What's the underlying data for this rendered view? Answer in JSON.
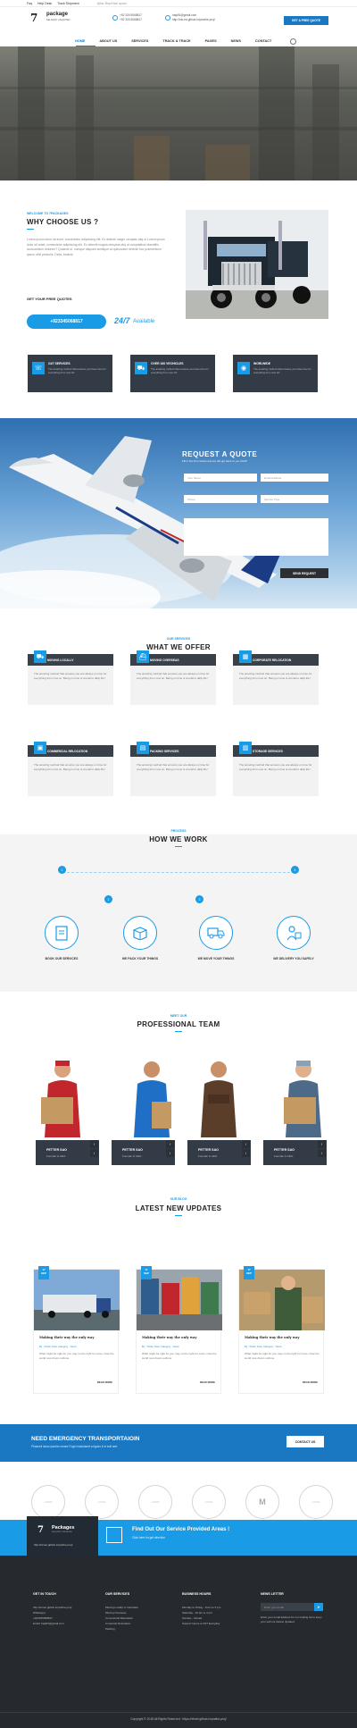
{
  "topbar": {
    "faq": "Faq",
    "help": "Help Desk",
    "track": "Track Shipment",
    "social": "@fac  Rep/Hwn  ayarn"
  },
  "logo": {
    "num": "7",
    "name": "package",
    "sub": "DELIVERY UNLIMITED"
  },
  "header": {
    "phone1": "+92 334 5068817",
    "phone2": "+92 334 5068817",
    "email": "haqlif1@gmail.com",
    "web": "http://etc-ed.github.io/pradhe-proj/",
    "quote_btn": "GET A FREE QUOTE"
  },
  "nav": {
    "items": [
      "HOME",
      "ABOUT US",
      "SERVICES",
      "TRACK & TRACE",
      "PAGES",
      "NEWS",
      "CONTACT"
    ]
  },
  "why": {
    "tag": "WELCOME TO 7PACKAGES",
    "title": "WHY CHOOSE US ?",
    "text": "Lorem ipsum dolor sit amet, consectetur adipisicing elit. Ex deleniti magni ceruptas aliq ut Lorem ipsum dolor sit amet, consectetur adipisicing elit. Ex deleniti magna ceruptas aliq ut voluptatibus blanditiis accusantium dolorem? Quaerat ut, cumque aliquam similique at quibusdam deleniti hoc praesentium ipsum nihil periculis. Dicta, beatus!",
    "quotes_label": "GET YOUR FREE QUOTES",
    "phone": "+923345068817",
    "avail_num": "24/7",
    "avail_txt": "Available"
  },
  "stats": [
    {
      "title": "24/7 SERVICES",
      "text": "The amazing method that ensures you have time for everything from now Hi!"
    },
    {
      "title": "OVER 180 VECHICLES",
      "text": "The amazing method that ensures you have time for everything from now Hi!"
    },
    {
      "title": "WORLWIDE",
      "text": "The amazing method that ensures you have time for everything from now Hi!"
    }
  ],
  "request": {
    "title": "REQUEST A QUOTE",
    "subtitle": "Fill in the form below and we will get back to you ASAP",
    "name": "Your Name",
    "email": "Email Address",
    "phone": "Phone",
    "service": "Service Type",
    "send": "SEND REQUEST"
  },
  "offer": {
    "tag": "OUR SERVICES",
    "title": "WHAT WE OFFER",
    "cards": [
      {
        "title": "MOVING LOCALLY",
        "text": "The amazing method that ensures you are always on time for everything from now on. Being on time is crucial to daily life!"
      },
      {
        "title": "MOVING OVERSEAS",
        "text": "The amazing method that ensures you are always on time for everything from now on. Being on time is crucial to daily life!"
      },
      {
        "title": "CORPORATE RELOCATION",
        "text": "The amazing method that ensures you are always on time for everything from now on. Being on time is crucial to daily life!"
      },
      {
        "title": "COMMERCIAL RELOCATION",
        "text": "The amazing method that ensures you are always on time for everything from now on. Being on time is crucial to daily life!"
      },
      {
        "title": "PACKING SERVICES",
        "text": "The amazing method that ensures you are always on time for everything from now on. Being on time is crucial to daily life!"
      },
      {
        "title": "STORAGE SERVICES",
        "text": "The amazing method that ensures you are always on time for everything from now on. Being on time is crucial to daily life!"
      }
    ]
  },
  "how": {
    "tag": "PROCESS",
    "title": "HOW WE WORK",
    "steps": [
      {
        "num": "1",
        "label": "BOOK OUR SERVICES"
      },
      {
        "num": "2",
        "label": "WE PACK YOUR THINGS"
      },
      {
        "num": "3",
        "label": "WE MOVE YOUR THINGS"
      },
      {
        "num": "4",
        "label": "WE DELIVERY YOU SAFELY"
      }
    ]
  },
  "team": {
    "tag": "MEET OUR",
    "title": "PROFESSIONAL TEAM",
    "members": [
      {
        "name": "PETTER SAO",
        "role": "Founder & CEO"
      },
      {
        "name": "PETTER SAO",
        "role": "Founder & CEO"
      },
      {
        "name": "PETTER SAO",
        "role": "Founder & CEO"
      },
      {
        "name": "PETTER SAO",
        "role": "Founder & CEO"
      }
    ]
  },
  "blog": {
    "tag": "OUR BLOG",
    "title": "LATEST NEW UPDATES",
    "posts": [
      {
        "day": "17",
        "mon": "SEP",
        "title": "Making their way the only way",
        "meta": "By : Petter Sven Category : News",
        "text": "What might be right for you may not be right for some. Now the world now drums softnus.",
        "more": "READ MORE"
      },
      {
        "day": "17",
        "mon": "SEP",
        "title": "Making their way the only way",
        "meta": "By : Petter Sven Category : News",
        "text": "What might be right for you may not be right for some. Now the world now drums softnus.",
        "more": "READ MORE"
      },
      {
        "day": "17",
        "mon": "SEP",
        "title": "Making their way the only way",
        "meta": "By : Petter Sven Category : News",
        "text": "What might be right for you may not be right for some. Now the world now drums softnus.",
        "more": "READ MORE"
      }
    ]
  },
  "emergency": {
    "title": "NEED EMERGENCY TRANSPORTAIOIN",
    "text": "Phasneli lacus ipsulim ornare Fuge inactulanet a ligudo it et eult amt",
    "btn": "CONTACT US"
  },
  "brands": [
    "LOGO",
    "LOGO",
    "LOGO",
    "LOGO",
    "M",
    "LOGO"
  ],
  "footer_logo": {
    "num": "7",
    "name": "Packages",
    "sub": "DELIVERY UNLIMITED",
    "url": "http://etmet.github.io/prathe-proj/"
  },
  "find": {
    "title": "Find Out Our Service Provided Areas !",
    "sub": "Click here for get direction"
  },
  "footer": {
    "col1": {
      "title": "GET IN TOUCH",
      "addr": "http://etmet.github.io/prathe-proj/",
      "wa_label": "Whatsapp :",
      "wa": "+923345068817",
      "mail": "Email: haqlif1@gmail.com"
    },
    "col2": {
      "title": "OUR SERVICES",
      "items": [
        "Moving Locally or Interstate",
        "Moving Overseas",
        "Commercial Relocation",
        "Corporate Relocation",
        "Packing"
      ]
    },
    "col3": {
      "title": "BUSINESS HOURS",
      "items": [
        "Monday to Friday - 8 am to 6 pm",
        "Saturday - 10 am to 4 pm",
        "Sunday - Closed",
        "Support Hours is 24/7 Everyday"
      ]
    },
    "col4": {
      "title": "NEWS LETTER",
      "placeholder": "Enter your email",
      "text": "Enter your email address for our mailing list to keep your self our lastest updated."
    },
    "copyright": "Copyright © 2018 All Rights Reserved : https://etmet.github.io/prathe-proj/"
  }
}
